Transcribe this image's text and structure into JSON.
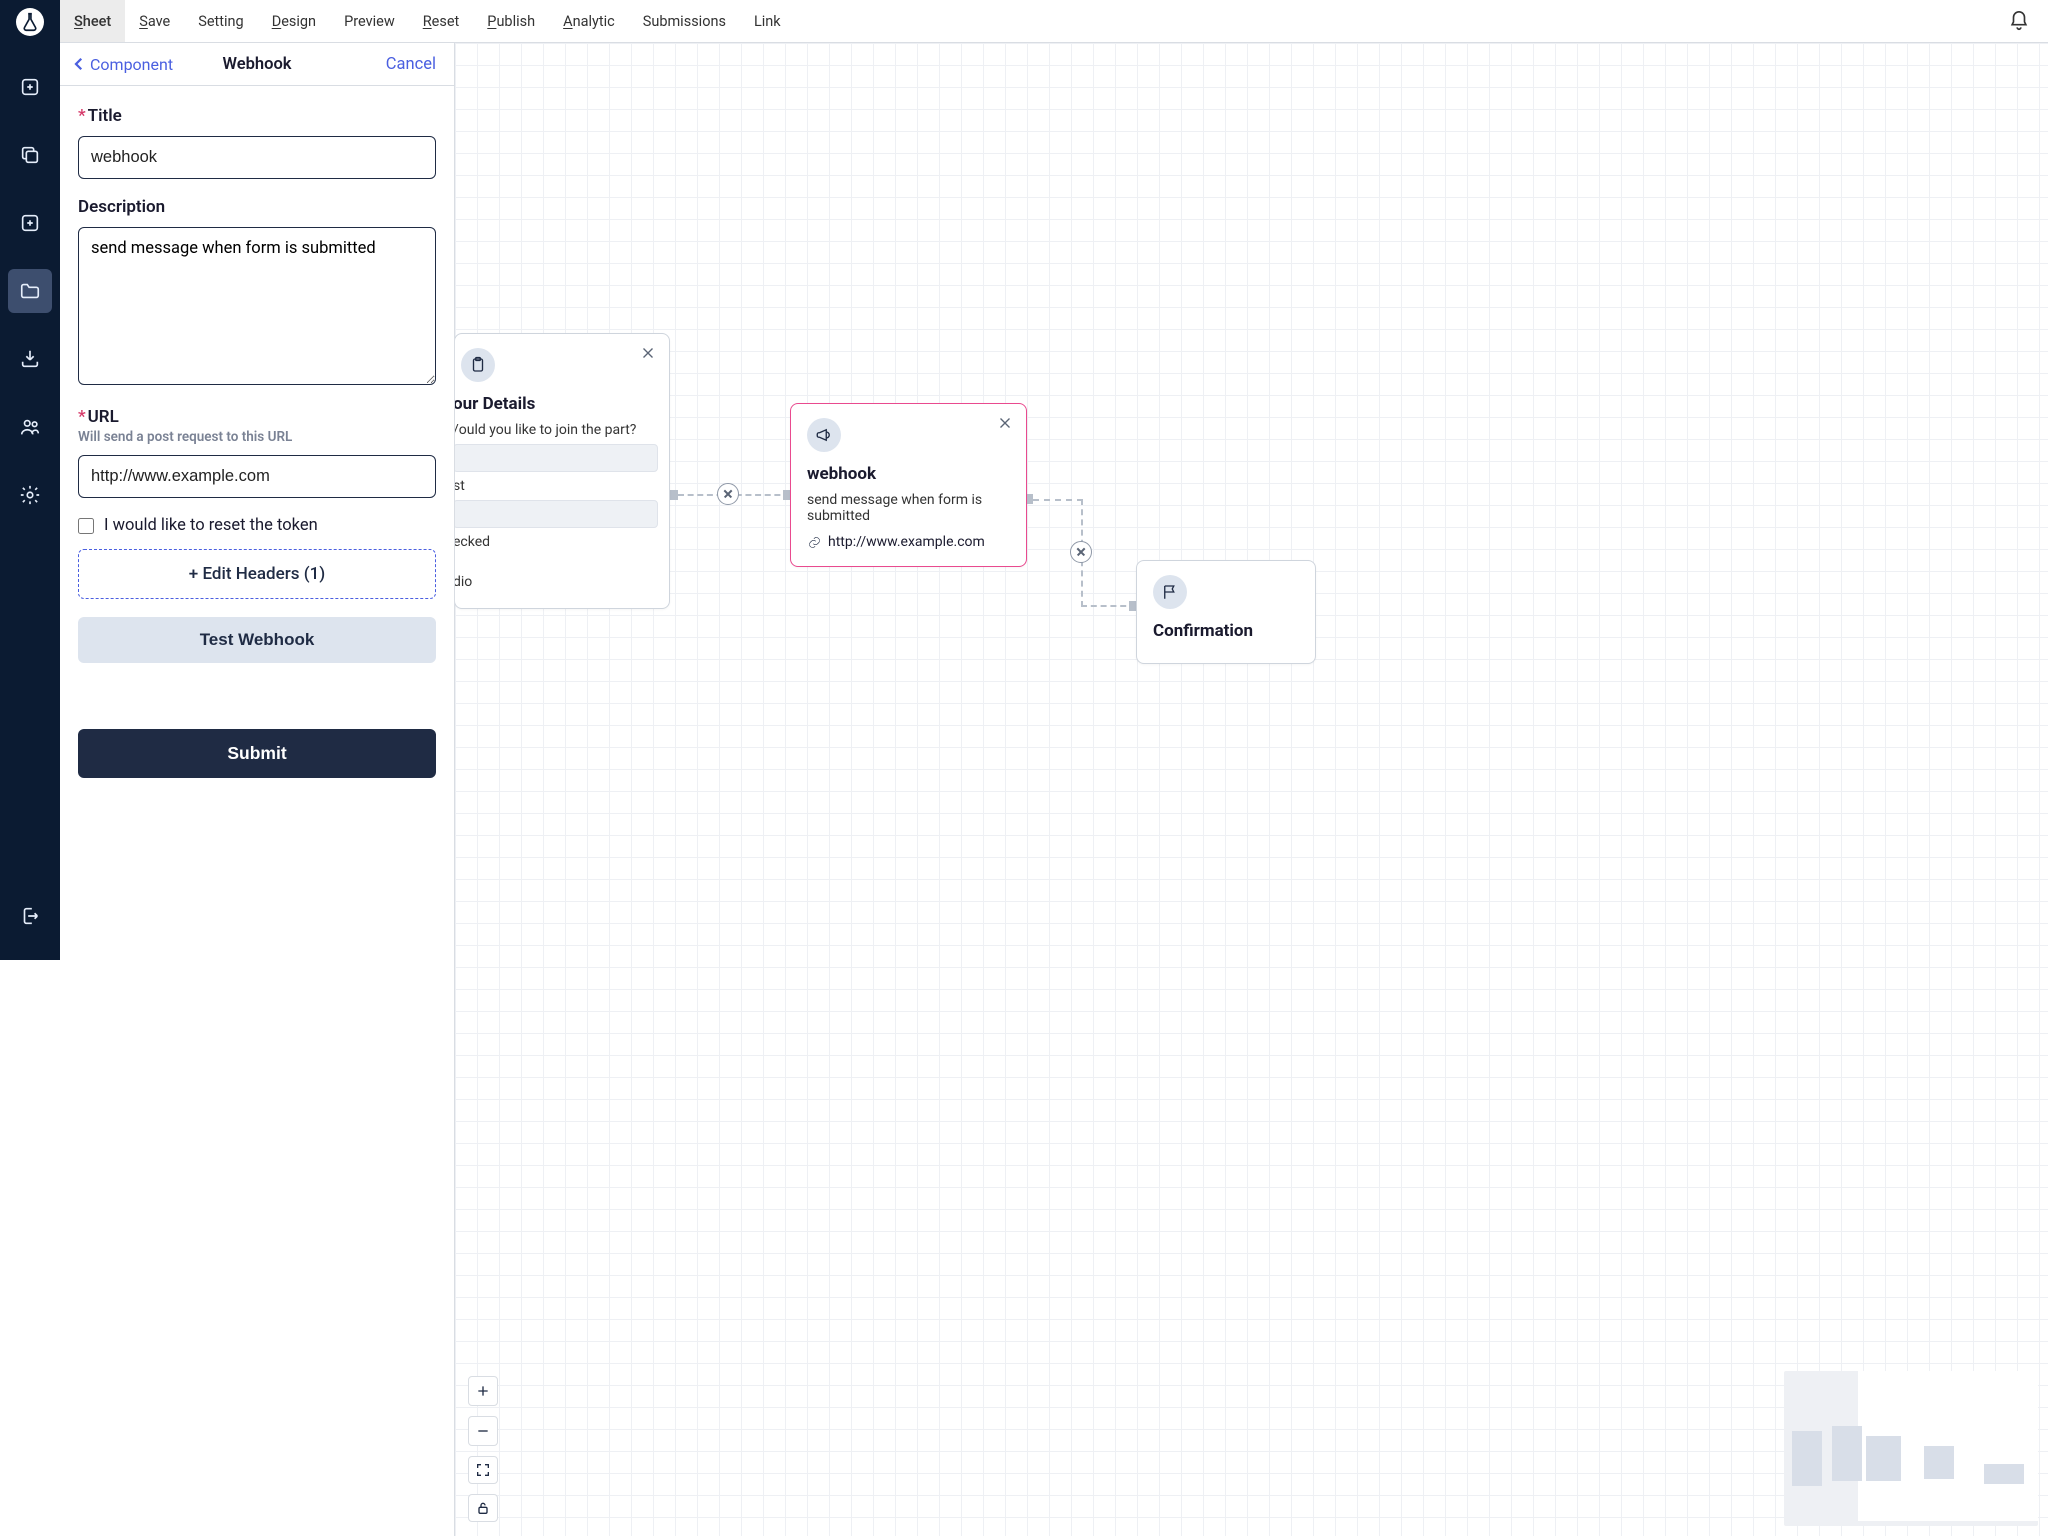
{
  "topbar": {
    "menus": [
      "Sheet",
      "Save",
      "Setting",
      "Design",
      "Preview",
      "Reset",
      "Publish",
      "Analytic",
      "Submissions",
      "Link"
    ]
  },
  "panel": {
    "breadcrumb": "Component",
    "title": "Webhook",
    "cancel": "Cancel",
    "title_label": "Title",
    "title_value": "webhook",
    "desc_label": "Description",
    "desc_value": "send message when form is submitted",
    "url_label": "URL",
    "url_hint": "Will send a post request to this URL",
    "url_value": "http://www.example.com",
    "reset_token": "I would like to reset the token",
    "edit_headers": "+ Edit Headers (1)",
    "test": "Test Webhook",
    "submit": "Submit"
  },
  "canvas": {
    "card1": {
      "title": "our Details",
      "q1": "/ould you like to join the part?",
      "opt1": "st",
      "opt2": "ecked",
      "opt3": "dio"
    },
    "card2": {
      "title": "webhook",
      "desc": "send message when form is submitted",
      "url": "http://www.example.com"
    },
    "card3": {
      "title": "Confirmation"
    }
  }
}
